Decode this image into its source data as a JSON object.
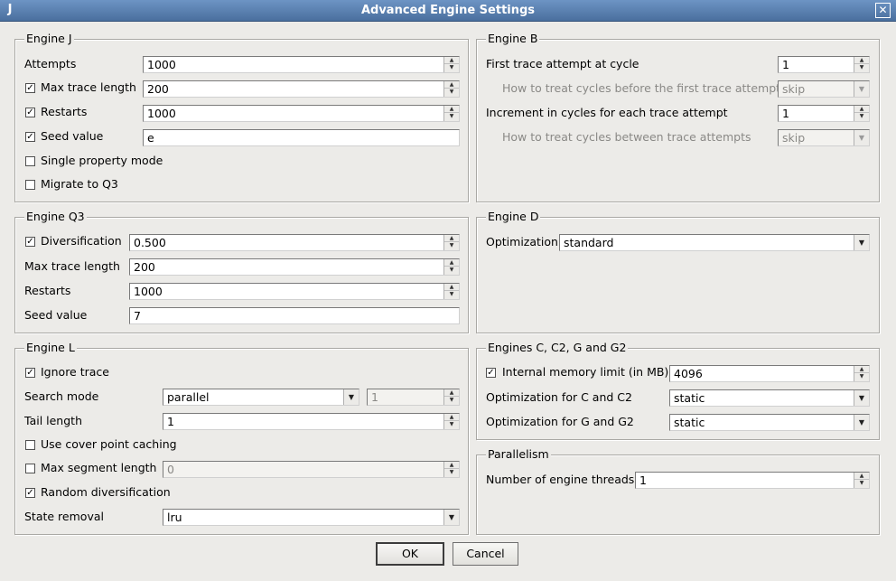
{
  "window": {
    "title": "Advanced Engine Settings",
    "app_icon": "java-icon",
    "close_glyph": "✕"
  },
  "engine_j": {
    "title": "Engine J",
    "attempts": {
      "label": "Attempts",
      "value": "1000"
    },
    "max_trace_length": {
      "label": "Max trace length",
      "checked": true,
      "value": "200"
    },
    "restarts": {
      "label": "Restarts",
      "checked": true,
      "value": "1000"
    },
    "seed_value": {
      "label": "Seed value",
      "checked": true,
      "value": "e"
    },
    "single_property_mode": {
      "label": "Single property mode",
      "checked": false
    },
    "migrate_to_q3": {
      "label": "Migrate to Q3",
      "checked": false
    }
  },
  "engine_b": {
    "title": "Engine B",
    "first_trace_attempt": {
      "label": "First trace attempt at cycle",
      "value": "1"
    },
    "cycles_before": {
      "label": "How to treat cycles before the first trace attempt",
      "value": "skip"
    },
    "increment": {
      "label": "Increment in cycles for each trace attempt",
      "value": "1"
    },
    "cycles_between": {
      "label": "How to treat cycles between trace attempts",
      "value": "skip"
    }
  },
  "engine_q3": {
    "title": "Engine Q3",
    "diversification": {
      "label": "Diversification",
      "checked": true,
      "value": "0.500"
    },
    "max_trace_length": {
      "label": "Max trace length",
      "value": "200"
    },
    "restarts": {
      "label": "Restarts",
      "value": "1000"
    },
    "seed_value": {
      "label": "Seed value",
      "value": "7"
    }
  },
  "engine_d": {
    "title": "Engine D",
    "optimization": {
      "label": "Optimization",
      "value": "standard"
    }
  },
  "engine_l": {
    "title": "Engine L",
    "ignore_trace": {
      "label": "Ignore trace",
      "checked": true
    },
    "search_mode": {
      "label": "Search mode",
      "value": "parallel",
      "count": "1"
    },
    "tail_length": {
      "label": "Tail length",
      "value": "1"
    },
    "cover_point_caching": {
      "label": "Use cover point caching",
      "checked": false
    },
    "max_segment_length": {
      "label": "Max segment length",
      "checked": false,
      "value": "0"
    },
    "random_diversification": {
      "label": "Random diversification",
      "checked": true
    },
    "state_removal": {
      "label": "State removal",
      "value": "lru"
    }
  },
  "engines_c": {
    "title": "Engines C, C2, G and G2",
    "memory_limit": {
      "label": "Internal memory limit (in MB)",
      "checked": true,
      "value": "4096"
    },
    "opt_c": {
      "label": "Optimization for C and C2",
      "value": "static"
    },
    "opt_g": {
      "label": "Optimization for G and G2",
      "value": "static"
    }
  },
  "parallelism": {
    "title": "Parallelism",
    "threads": {
      "label": "Number of engine threads",
      "value": "1"
    }
  },
  "buttons": {
    "ok": "OK",
    "cancel": "Cancel"
  },
  "glyphs": {
    "check": "✓",
    "spin_up": "▲",
    "spin_down": "▼",
    "combo_arrow": "▼"
  }
}
